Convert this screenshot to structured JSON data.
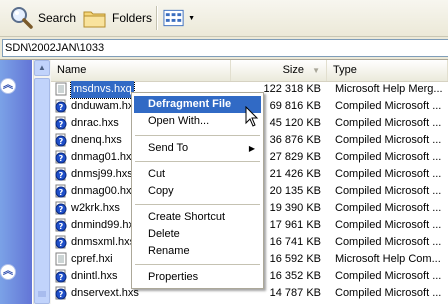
{
  "toolbar": {
    "search_label": "Search",
    "folders_label": "Folders"
  },
  "address": {
    "path": "SDN\\2002JAN\\1033"
  },
  "columns": {
    "name": "Name",
    "size": "Size",
    "type": "Type"
  },
  "files": [
    {
      "name": "msdnvs.hxq",
      "size": "122 318 KB",
      "type": "Microsoft Help Merg...",
      "icon": "help-file-icon"
    },
    {
      "name": "dnduwam.hxs",
      "size": "69 816 KB",
      "type": "Compiled Microsoft ...",
      "icon": "compiled-help-icon"
    },
    {
      "name": "dnrac.hxs",
      "size": "45 120 KB",
      "type": "Compiled Microsoft ...",
      "icon": "compiled-help-icon"
    },
    {
      "name": "dnenq.hxs",
      "size": "36 876 KB",
      "type": "Compiled Microsoft ...",
      "icon": "compiled-help-icon"
    },
    {
      "name": "dnmag01.hxs",
      "size": "27 829 KB",
      "type": "Compiled Microsoft ...",
      "icon": "compiled-help-icon"
    },
    {
      "name": "dnmsj99.hxs",
      "size": "21 426 KB",
      "type": "Compiled Microsoft ...",
      "icon": "compiled-help-icon"
    },
    {
      "name": "dnmag00.hxs",
      "size": "20 135 KB",
      "type": "Compiled Microsoft ...",
      "icon": "compiled-help-icon"
    },
    {
      "name": "w2krk.hxs",
      "size": "19 390 KB",
      "type": "Compiled Microsoft ...",
      "icon": "compiled-help-icon"
    },
    {
      "name": "dnmind99.hxs",
      "size": "17 961 KB",
      "type": "Compiled Microsoft ...",
      "icon": "compiled-help-icon"
    },
    {
      "name": "dnmsxml.hxs",
      "size": "16 741 KB",
      "type": "Compiled Microsoft ...",
      "icon": "compiled-help-icon"
    },
    {
      "name": "cpref.hxi",
      "size": "16 592 KB",
      "type": "Microsoft Help Com...",
      "icon": "help-index-icon"
    },
    {
      "name": "dnintl.hxs",
      "size": "16 352 KB",
      "type": "Compiled Microsoft ...",
      "icon": "compiled-help-icon"
    },
    {
      "name": "dnservext.hxs",
      "size": "14 787 KB",
      "type": "Compiled Microsoft ...",
      "icon": "compiled-help-icon"
    }
  ],
  "context_menu": {
    "defragment": "Defragment File",
    "open_with": "Open With...",
    "send_to": "Send To",
    "cut": "Cut",
    "copy": "Copy",
    "create_shortcut": "Create Shortcut",
    "delete": "Delete",
    "rename": "Rename",
    "properties": "Properties"
  },
  "colors": {
    "selection": "#316ac5",
    "taskpane_start": "#7ba2e7",
    "taskpane_end": "#6375d6"
  }
}
